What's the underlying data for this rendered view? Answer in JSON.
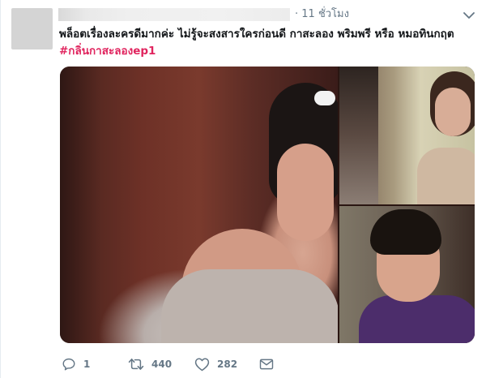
{
  "tweet": {
    "timestamp": "· 11 ชั่วโมง",
    "text_line1": "พล็อตเรื่องละครดีมากค่ะ ไม่รู้จะสงสารใครก่อนดี กาสะลอง พริมพรี หรือ หมอทินกฤต",
    "hashtag": "#กลิ่นกาสะลองep1",
    "media": {
      "count": 3
    }
  },
  "actions": {
    "reply_count": "1",
    "retweet_count": "440",
    "like_count": "282"
  },
  "icons": {
    "caret": "chevron-down-icon",
    "reply": "reply-icon",
    "retweet": "retweet-icon",
    "like": "heart-icon",
    "dm": "envelope-icon"
  },
  "colors": {
    "hashtag": "#e0245e",
    "muted": "#657786",
    "text": "#14171a"
  }
}
